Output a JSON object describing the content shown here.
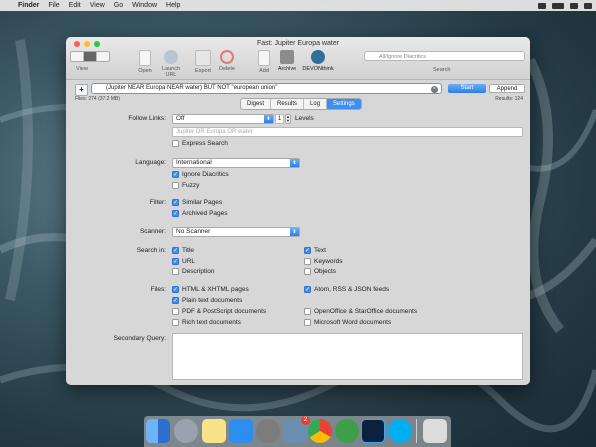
{
  "menubar": {
    "app": "Finder",
    "items": [
      "File",
      "Edit",
      "View",
      "Go",
      "Window",
      "Help"
    ]
  },
  "window": {
    "title": "Fast: Jupiter Europa water"
  },
  "toolbar": {
    "view_label": "View",
    "open": "Open",
    "launch_url": "Launch URL",
    "export": "Export",
    "delete": "Delete",
    "add": "Add",
    "archive": "Archive",
    "devonthink": "DEVONthink",
    "search_placeholder": "All/Ignore Diacritics",
    "search_label": "Search"
  },
  "query": {
    "add_button": "+",
    "value": "(Jupiter NEAR Europa NEAR water) BUT NOT \"european union\"",
    "start": "Start",
    "append": "Append",
    "files": "Files: 274 (37.2 MB)",
    "results": "Results: 124"
  },
  "tabs": [
    {
      "label": "Digest",
      "selected": false
    },
    {
      "label": "Results",
      "selected": false
    },
    {
      "label": "Log",
      "selected": false
    },
    {
      "label": "Settings",
      "selected": true
    }
  ],
  "settings": {
    "follow_links_label": "Follow Links:",
    "follow_links_value": "Off",
    "levels_value": "1",
    "levels_label": "Levels",
    "follow_pattern_placeholder": "Jupiter OR Europa OR water",
    "express_search": "Express Search",
    "language_label": "Language:",
    "language_value": "International",
    "ignore_diacritics": "Ignore Diacritics",
    "fuzzy": "Fuzzy",
    "filter_label": "Filter:",
    "similar_pages": "Similar Pages",
    "archived_pages": "Archived Pages",
    "scanner_label": "Scanner:",
    "scanner_value": "No Scanner",
    "search_in_label": "Search in:",
    "search_in": {
      "title": "Title",
      "text": "Text",
      "url": "URL",
      "keywords": "Keywords",
      "description": "Description",
      "objects": "Objects"
    },
    "files_label": "Files:",
    "files": {
      "html": "HTML & XHTML pages",
      "atom": "Atom, RSS & JSON feeds",
      "plain": "Plain text documents",
      "pdf": "PDF & PostScript documents",
      "openoffice": "OpenOffice & StarOffice documents",
      "rich": "Rich text documents",
      "word": "Microsoft Word documents"
    },
    "secondary_query_label": "Secondary Query:"
  },
  "dock_badge": "2",
  "colors": {
    "accent": "#3f8ef0",
    "window_bg": "#d7d7d7"
  }
}
